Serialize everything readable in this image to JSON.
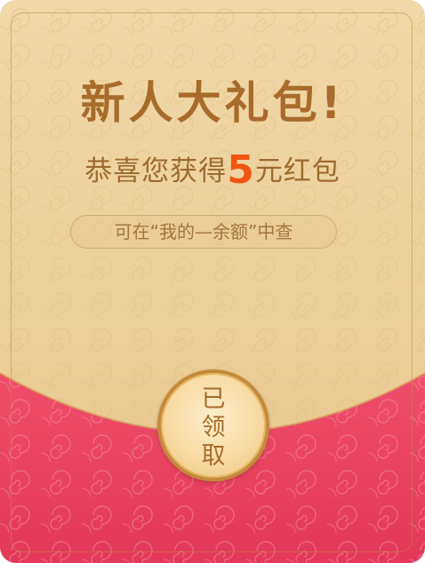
{
  "card": {
    "title": "新人大礼包!",
    "subtitle_prefix": "恭喜您获得",
    "amount": "5",
    "subtitle_suffix": "元红包",
    "hint": "可在“我的—余额”中查",
    "claim_button": {
      "chars": [
        "已",
        "领",
        "取"
      ]
    }
  },
  "colors": {
    "gold_bg": "#eccf99",
    "red_bg": "#e83a5c",
    "title_text": "#a86b2c",
    "amount_accent": "#f25512"
  }
}
